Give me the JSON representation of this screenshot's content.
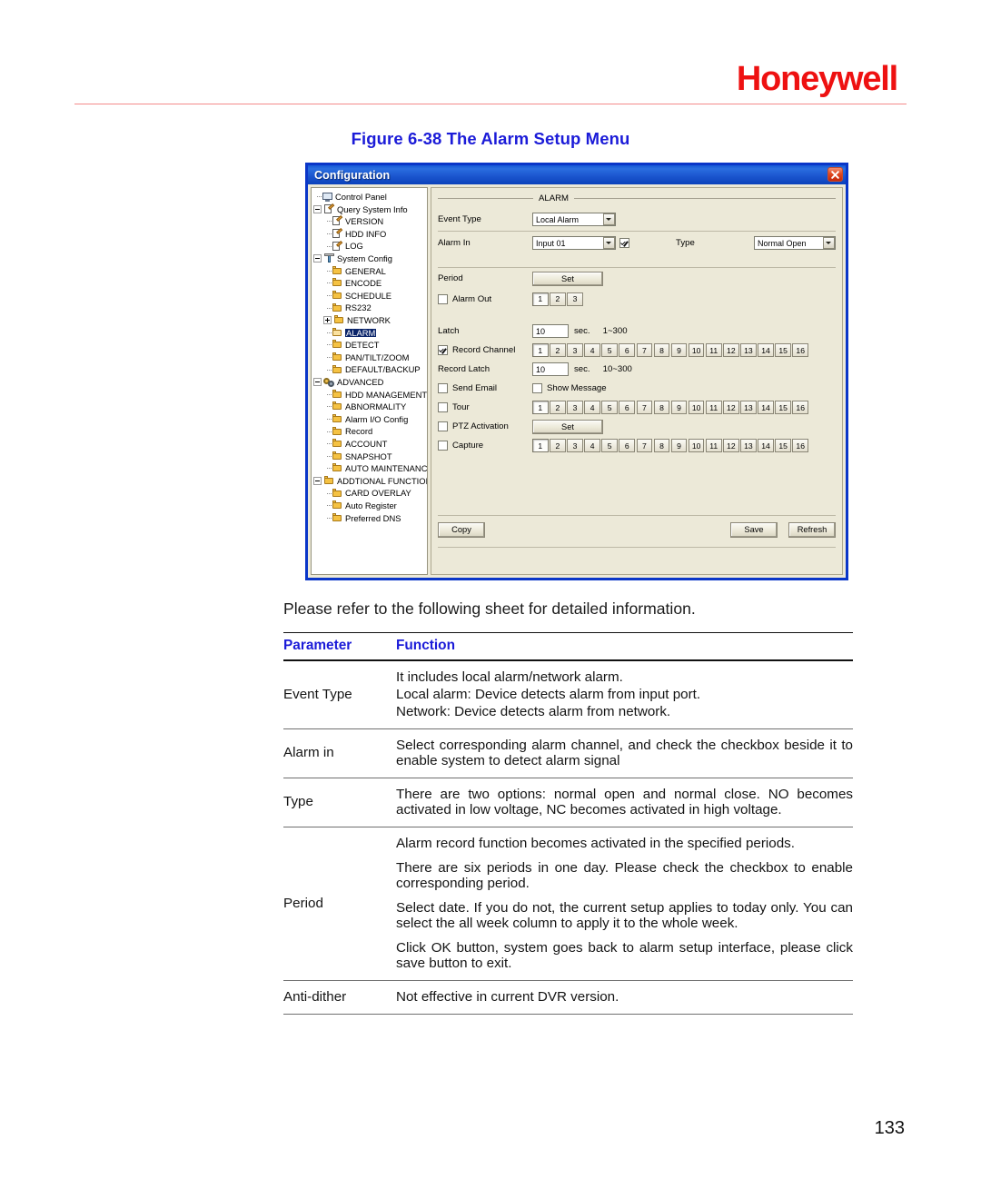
{
  "page": {
    "brand": "Honeywell",
    "page_number": "133",
    "figure_caption": "Figure 6-38 The Alarm Setup Menu",
    "intro_text": "Please refer to the following sheet for detailed information.",
    "accent_red": "#ee1111",
    "accent_blue": "#1b1bd8"
  },
  "dialog": {
    "title": "Configuration",
    "close_label": "×",
    "group_title": "ALARM",
    "tree": [
      {
        "label": "Control Panel",
        "indent": 0,
        "icon": "monitor-icon",
        "expander": "none",
        "selected": false
      },
      {
        "label": "Query System Info",
        "indent": 0,
        "icon": "doc-icon",
        "expander": "minus",
        "selected": false
      },
      {
        "label": "VERSION",
        "indent": 1,
        "icon": "doc-icon",
        "expander": "none",
        "selected": false
      },
      {
        "label": "HDD INFO",
        "indent": 1,
        "icon": "doc-icon",
        "expander": "none",
        "selected": false
      },
      {
        "label": "LOG",
        "indent": 1,
        "icon": "doc-icon",
        "expander": "none",
        "selected": false
      },
      {
        "label": "System Config",
        "indent": 0,
        "icon": "tool-icon",
        "expander": "minus",
        "selected": false
      },
      {
        "label": "GENERAL",
        "indent": 1,
        "icon": "folder-icon",
        "expander": "none",
        "selected": false
      },
      {
        "label": "ENCODE",
        "indent": 1,
        "icon": "folder-icon",
        "expander": "none",
        "selected": false
      },
      {
        "label": "SCHEDULE",
        "indent": 1,
        "icon": "folder-icon",
        "expander": "none",
        "selected": false
      },
      {
        "label": "RS232",
        "indent": 1,
        "icon": "folder-icon",
        "expander": "none",
        "selected": false
      },
      {
        "label": "NETWORK",
        "indent": 1,
        "icon": "folder-icon",
        "expander": "plus",
        "selected": false
      },
      {
        "label": "ALARM",
        "indent": 1,
        "icon": "folder-open-icon",
        "expander": "none",
        "selected": true
      },
      {
        "label": "DETECT",
        "indent": 1,
        "icon": "folder-icon",
        "expander": "none",
        "selected": false
      },
      {
        "label": "PAN/TILT/ZOOM",
        "indent": 1,
        "icon": "folder-icon",
        "expander": "none",
        "selected": false
      },
      {
        "label": "DEFAULT/BACKUP",
        "indent": 1,
        "icon": "folder-icon",
        "expander": "none",
        "selected": false
      },
      {
        "label": "ADVANCED",
        "indent": 0,
        "icon": "gears-icon",
        "expander": "minus",
        "selected": false
      },
      {
        "label": "HDD MANAGEMENT",
        "indent": 1,
        "icon": "folder-icon",
        "expander": "none",
        "selected": false
      },
      {
        "label": "ABNORMALITY",
        "indent": 1,
        "icon": "folder-icon",
        "expander": "none",
        "selected": false
      },
      {
        "label": "Alarm I/O Config",
        "indent": 1,
        "icon": "folder-icon",
        "expander": "none",
        "selected": false
      },
      {
        "label": "Record",
        "indent": 1,
        "icon": "folder-icon",
        "expander": "none",
        "selected": false
      },
      {
        "label": "ACCOUNT",
        "indent": 1,
        "icon": "folder-icon",
        "expander": "none",
        "selected": false
      },
      {
        "label": "SNAPSHOT",
        "indent": 1,
        "icon": "folder-icon",
        "expander": "none",
        "selected": false
      },
      {
        "label": "AUTO MAINTENANCE",
        "indent": 1,
        "icon": "folder-icon",
        "expander": "none",
        "selected": false
      },
      {
        "label": "ADDTIONAL FUNCTION",
        "indent": 0,
        "icon": "folder-icon",
        "expander": "minus",
        "selected": false
      },
      {
        "label": "CARD OVERLAY",
        "indent": 1,
        "icon": "folder-icon",
        "expander": "none",
        "selected": false
      },
      {
        "label": "Auto Register",
        "indent": 1,
        "icon": "folder-icon",
        "expander": "none",
        "selected": false
      },
      {
        "label": "Preferred DNS",
        "indent": 1,
        "icon": "folder-icon",
        "expander": "none",
        "selected": false
      }
    ],
    "form": {
      "event_type_label": "Event Type",
      "event_type_value": "Local Alarm",
      "alarm_in_label": "Alarm In",
      "alarm_in_value": "Input 01",
      "alarm_in_checked": true,
      "type_label": "Type",
      "type_value": "Normal Open",
      "period_label": "Period",
      "period_set_label": "Set",
      "alarm_out_label": "Alarm Out",
      "alarm_out_channels": [
        "1",
        "2",
        "3"
      ],
      "latch_label": "Latch",
      "latch_value": "10",
      "latch_unit": "sec.",
      "latch_range": "1~300",
      "record_channel_label": "Record Channel",
      "record_latch_label": "Record Latch",
      "record_latch_value": "10",
      "record_latch_unit": "sec.",
      "record_latch_range": "10~300",
      "send_email_label": "Send Email",
      "show_message_label": "Show Message",
      "tour_label": "Tour",
      "ptz_activation_label": "PTZ Activation",
      "ptz_set_label": "Set",
      "capture_label": "Capture",
      "channels": [
        "1",
        "2",
        "3",
        "4",
        "5",
        "6",
        "7",
        "8",
        "9",
        "10",
        "11",
        "12",
        "13",
        "14",
        "15",
        "16"
      ]
    },
    "buttons": {
      "copy": "Copy",
      "save": "Save",
      "refresh": "Refresh"
    }
  },
  "table": {
    "headers": {
      "parameter": "Parameter",
      "function": "Function"
    },
    "rows": [
      {
        "parameter": "Event Type",
        "lines": [
          "It includes local alarm/network alarm.",
          "Local alarm: Device detects alarm from input port.",
          "Network: Device detects alarm from network."
        ]
      },
      {
        "parameter": "Alarm in",
        "lines": [
          "Select corresponding alarm channel, and check the checkbox beside it to enable system to detect alarm signal"
        ]
      },
      {
        "parameter": "Type",
        "lines": [
          "There are two options: normal open and normal close. NO becomes activated in low voltage, NC becomes activated in high voltage."
        ]
      },
      {
        "parameter": "Period",
        "lines": [
          "Alarm record function becomes activated in the specified periods.",
          "There are six periods in one day. Please check the checkbox to enable corresponding period.",
          "Select date. If you do not, the current setup applies to today only. You can select the all week column to apply it to the whole week.",
          "Click OK button, system goes back to alarm setup interface, please click save button to exit."
        ]
      },
      {
        "parameter": "Anti-dither",
        "lines": [
          "Not effective in current DVR version."
        ]
      }
    ]
  }
}
